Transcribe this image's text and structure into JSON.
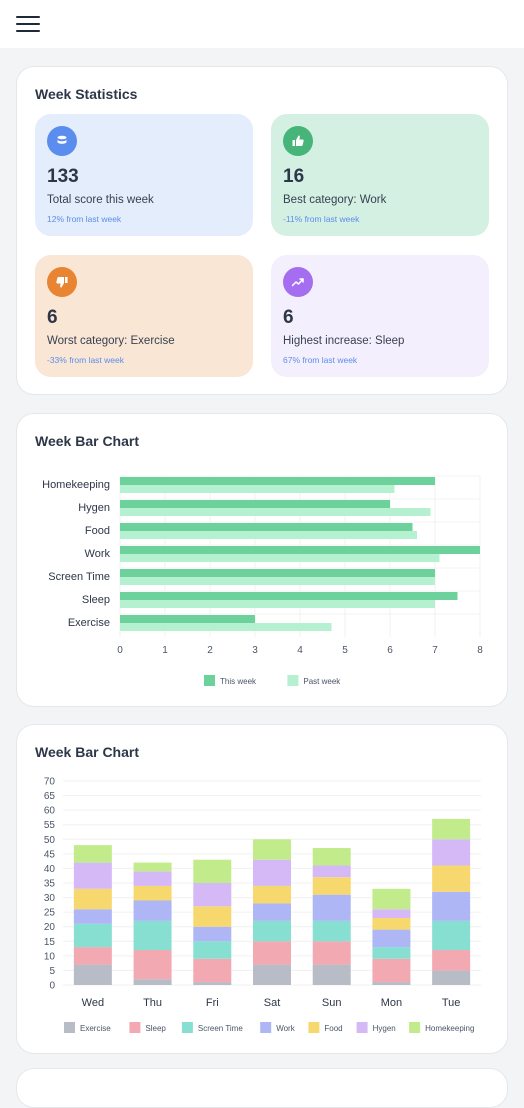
{
  "nav": {
    "menu_icon": "hamburger-menu-icon"
  },
  "stats_card": {
    "title": "Week Statistics",
    "tiles": [
      {
        "value": "133",
        "label": "Total score this week",
        "delta": "12% from last week",
        "icon": "database-icon",
        "bg": "#e3edfb",
        "icon_bg": "#5b8def"
      },
      {
        "value": "16",
        "label": "Best category: Work",
        "delta": "-11% from last week",
        "icon": "thumbs-up-icon",
        "bg": "#d3f0e2",
        "icon_bg": "#47b57a"
      },
      {
        "value": "6",
        "label": "Worst category: Exercise",
        "delta": "-33% from last week",
        "icon": "thumbs-down-icon",
        "bg": "#f9e6d5",
        "icon_bg": "#e98432"
      },
      {
        "value": "6",
        "label": "Highest increase: Sleep",
        "delta": "67% from last week",
        "icon": "trending-up-icon",
        "bg": "#f4effd",
        "icon_bg": "#a56ef0"
      }
    ]
  },
  "hbar_card": {
    "title": "Week Bar Chart"
  },
  "stack_card": {
    "title": "Week Bar Chart"
  },
  "chart_data": [
    {
      "type": "bar",
      "orientation": "horizontal",
      "categories": [
        "Homekeeping",
        "Hygen",
        "Food",
        "Work",
        "Screen Time",
        "Sleep",
        "Exercise"
      ],
      "series": [
        {
          "name": "This week",
          "values": [
            7,
            6,
            6.5,
            8,
            7,
            7.5,
            3
          ],
          "color": "#6dd19b"
        },
        {
          "name": "Past week",
          "values": [
            6.1,
            6.9,
            6.6,
            7.1,
            7,
            7,
            4.7
          ],
          "color": "#b5f0d0"
        }
      ],
      "xlim": [
        0,
        8
      ],
      "xticks": [
        "0",
        "1",
        "2",
        "3",
        "4",
        "5",
        "6",
        "7",
        "8"
      ],
      "legend": "bottom",
      "grid": true
    },
    {
      "type": "bar",
      "stacked": true,
      "categories": [
        "Wed",
        "Thu",
        "Fri",
        "Sat",
        "Sun",
        "Mon",
        "Tue"
      ],
      "series": [
        {
          "name": "Exercise",
          "values": [
            7,
            2,
            1,
            7,
            7,
            1,
            5
          ],
          "color": "#b8bcc6"
        },
        {
          "name": "Sleep",
          "values": [
            6,
            10,
            8,
            8,
            8,
            8,
            7
          ],
          "color": "#f2a9b2"
        },
        {
          "name": "Screen Time",
          "values": [
            8,
            10,
            6,
            7,
            7,
            4,
            10
          ],
          "color": "#87dfd1"
        },
        {
          "name": "Work",
          "values": [
            5,
            7,
            5,
            6,
            9,
            6,
            10
          ],
          "color": "#aeb6f5"
        },
        {
          "name": "Food",
          "values": [
            7,
            5,
            7,
            6,
            6,
            4,
            9
          ],
          "color": "#f6d86e"
        },
        {
          "name": "Hygen",
          "values": [
            9,
            5,
            8,
            9,
            4,
            3,
            9
          ],
          "color": "#d5b9f7"
        },
        {
          "name": "Homekeeping",
          "values": [
            6,
            3,
            8,
            7,
            6,
            7,
            7
          ],
          "color": "#c2ec8b"
        }
      ],
      "ylim": [
        0,
        70
      ],
      "yticks": [
        "0",
        "5",
        "10",
        "15",
        "20",
        "25",
        "30",
        "35",
        "40",
        "45",
        "50",
        "55",
        "60",
        "65",
        "70"
      ],
      "legend": "bottom",
      "grid": true
    }
  ]
}
